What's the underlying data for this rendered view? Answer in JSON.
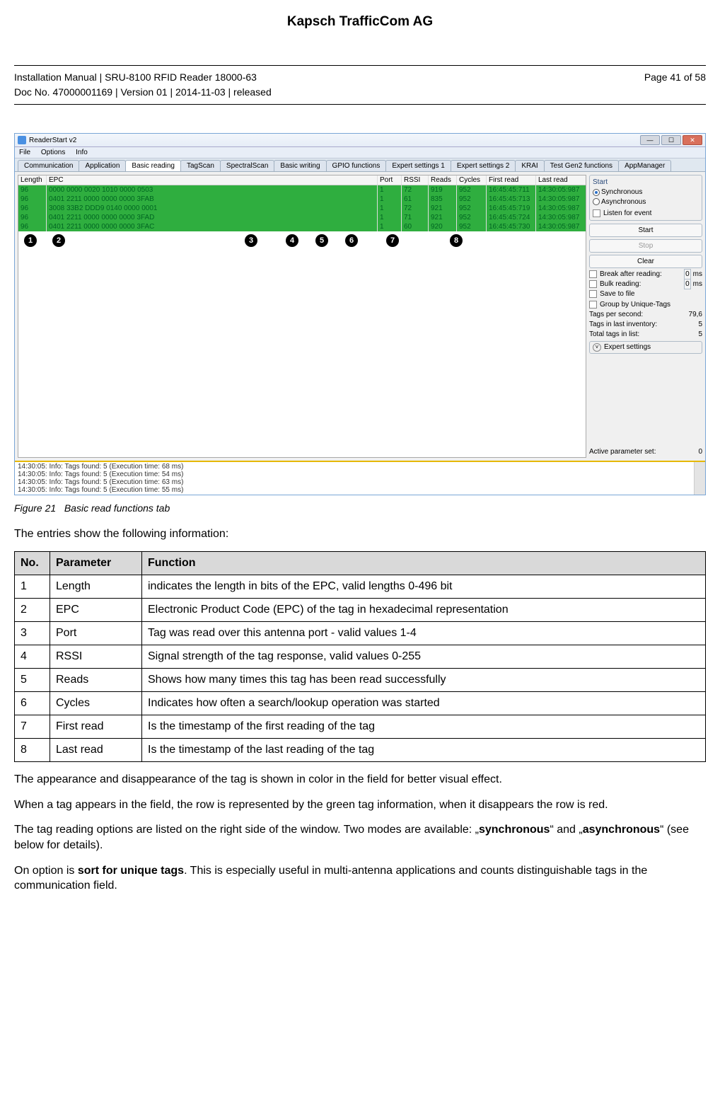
{
  "page_title": "Kapsch TrafficCom AG",
  "header": {
    "line1": "Installation Manual | SRU-8100 RFID Reader 18000-63",
    "line2": "Doc No. 47000001169 | Version 01 | 2014-11-03 | released",
    "page_of": "Page 41 of 58"
  },
  "screenshot": {
    "window_title": "ReaderStart v2",
    "menu": [
      "File",
      "Options",
      "Info"
    ],
    "tabs": [
      "Communication",
      "Application",
      "Basic reading",
      "TagScan",
      "SpectralScan",
      "Basic writing",
      "GPIO functions",
      "Expert settings 1",
      "Expert settings 2",
      "KRAI",
      "Test Gen2 functions",
      "AppManager"
    ],
    "active_tab_index": 2,
    "columns": [
      "Length",
      "EPC",
      "Port",
      "RSSI",
      "Reads",
      "Cycles",
      "First read",
      "Last read"
    ],
    "rows": [
      {
        "length": "96",
        "epc": "0000 0000 0020 1010 0000 0503",
        "port": "1",
        "rssi": "72",
        "reads": "919",
        "cycles": "952",
        "first": "16:45:45:711",
        "last": "14:30:05:987"
      },
      {
        "length": "96",
        "epc": "0401 2211 0000 0000 0000 3FAB",
        "port": "1",
        "rssi": "61",
        "reads": "835",
        "cycles": "952",
        "first": "16:45:45:713",
        "last": "14:30:05:987"
      },
      {
        "length": "96",
        "epc": "3008 33B2 DDD9 0140 0000 0001",
        "port": "1",
        "rssi": "72",
        "reads": "921",
        "cycles": "952",
        "first": "16:45:45:719",
        "last": "14:30:05:987"
      },
      {
        "length": "96",
        "epc": "0401 2211 0000 0000 0000 3FAD",
        "port": "1",
        "rssi": "71",
        "reads": "921",
        "cycles": "952",
        "first": "16:45:45:724",
        "last": "14:30:05:987"
      },
      {
        "length": "96",
        "epc": "0401 2211 0000 0000 0000 3FAC",
        "port": "1",
        "rssi": "60",
        "reads": "920",
        "cycles": "952",
        "first": "16:45:45:730",
        "last": "14:30:05:987"
      }
    ],
    "circle_labels": [
      "1",
      "2",
      "3",
      "4",
      "5",
      "6",
      "7",
      "8"
    ],
    "side": {
      "group_title": "Start",
      "sync_label": "Synchronous",
      "async_label": "Asynchronous",
      "listen_label": "Listen for event",
      "start_btn": "Start",
      "stop_btn": "Stop",
      "clear_btn": "Clear",
      "break_label": "Break after reading:",
      "break_val": "0",
      "ms": "ms",
      "bulk_label": "Bulk reading:",
      "bulk_val": "0",
      "save_label": "Save to file",
      "group_label": "Group by Unique-Tags",
      "tags_sec_label": "Tags per second:",
      "tags_sec_val": "79,6",
      "tags_inv_label": "Tags in last inventory:",
      "tags_inv_val": "5",
      "total_label": "Total tags in list:",
      "total_val": "5",
      "expert_label": "Expert settings",
      "active_set_label": "Active parameter set:",
      "active_set_val": "0"
    },
    "log_lines": [
      "14:30:05: Info: Tags found: 5 (Execution time: 68 ms)",
      "14:30:05: Info: Tags found: 5 (Execution time: 54 ms)",
      "14:30:05: Info: Tags found: 5 (Execution time: 63 ms)",
      "14:30:05: Info: Tags found: 5 (Execution time: 55 ms)"
    ]
  },
  "figure_caption_prefix": "Figure 21",
  "figure_caption_text": "Basic read functions tab",
  "intro_text": "The entries show the following information:",
  "table_headers": {
    "no": "No.",
    "param": "Parameter",
    "func": "Function"
  },
  "param_table": [
    {
      "no": "1",
      "param": "Length",
      "func": " indicates the length in bits of the EPC, valid lengths 0-496 bit"
    },
    {
      "no": "2",
      "param": "EPC",
      "func": "Electronic Product Code (EPC) of the tag in hexadecimal representation"
    },
    {
      "no": "3",
      "param": "Port",
      "func": "Tag was read over this antenna port -  valid values 1-4"
    },
    {
      "no": "4",
      "param": "RSSI",
      "func": "Signal strength of the tag response, valid values 0-255"
    },
    {
      "no": "5",
      "param": "Reads",
      "func": "Shows how many times this tag has been read successfully"
    },
    {
      "no": "6",
      "param": "Cycles",
      "func": "Indicates how often a search/lookup operation was started"
    },
    {
      "no": "7",
      "param": "First read",
      "func": "Is the timestamp of the first reading of the tag"
    },
    {
      "no": "8",
      "param": "Last read",
      "func": "Is the timestamp of the last reading of the tag"
    }
  ],
  "paragraphs": {
    "p1": "The appearance and disappearance of the tag is shown in color in the field for better visual effect.",
    "p2": "When a tag appears in the field, the row is represented by the green tag information, when it disappears the row is red.",
    "p3a": "The tag reading options are listed on the right side of the window. Two modes are available: „",
    "p3b": "synchronous",
    "p3c": "“ and „",
    "p3d": "asynchronous",
    "p3e": "“ (see below for details).",
    "p4a": "On option is ",
    "p4b": "sort for unique tags",
    "p4c": ". This is especially useful in multi-antenna applications and counts distinguishable tags in the communication field."
  }
}
